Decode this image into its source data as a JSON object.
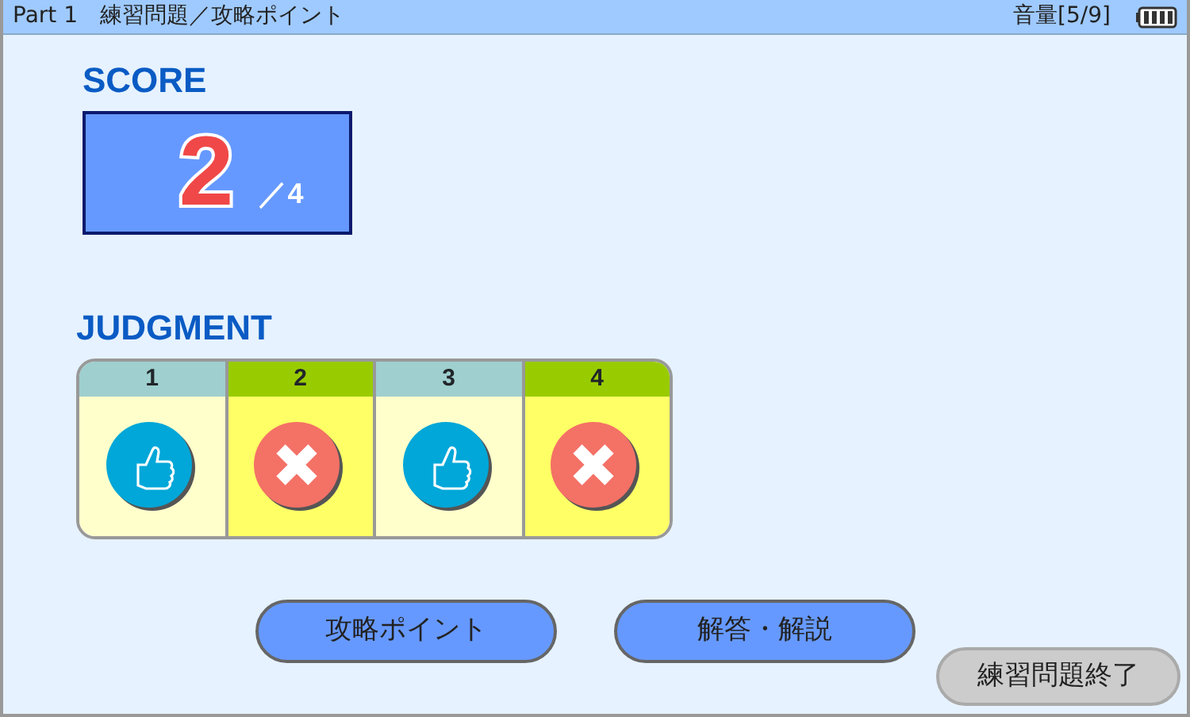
{
  "title_bar": {
    "title": "Part 1　練習問題／攻略ポイント",
    "volume": "音量[5/9]"
  },
  "score": {
    "heading": "SCORE",
    "value": "2",
    "total": "／4"
  },
  "judgment": {
    "heading": "JUDGMENT",
    "items": [
      {
        "number": "1",
        "correct": true
      },
      {
        "number": "2",
        "correct": false
      },
      {
        "number": "3",
        "correct": true
      },
      {
        "number": "4",
        "correct": false
      }
    ]
  },
  "buttons": [
    {
      "label": "攻略ポイント"
    },
    {
      "label": "解答・解説"
    }
  ],
  "end_button": {
    "label": "練習問題終了"
  }
}
